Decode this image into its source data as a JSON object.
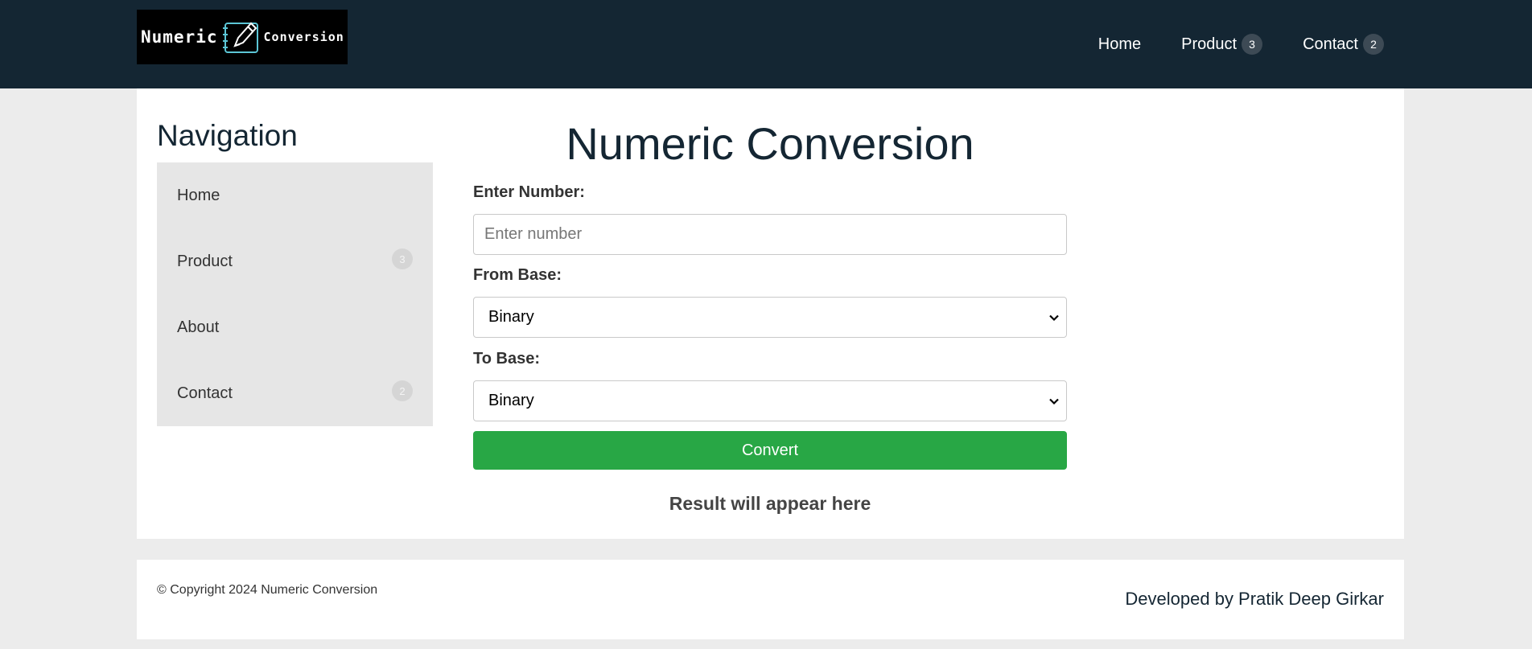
{
  "header": {
    "logo": {
      "word1": "Numeric",
      "word2": "Conversion",
      "icon": "pen-tablet-icon"
    },
    "nav": [
      {
        "label": "Home",
        "badge": ""
      },
      {
        "label": "Product",
        "badge": "3"
      },
      {
        "label": "Contact",
        "badge": "2"
      }
    ]
  },
  "sidebar": {
    "title": "Navigation",
    "items": [
      {
        "label": "Home",
        "badge": ""
      },
      {
        "label": "Product",
        "badge": "3"
      },
      {
        "label": "About",
        "badge": ""
      },
      {
        "label": "Contact",
        "badge": "2"
      }
    ]
  },
  "converter": {
    "title": "Numeric Conversion",
    "number_label": "Enter Number:",
    "number_placeholder": "Enter number",
    "number_value": "",
    "from_label": "From Base:",
    "from_value": "Binary",
    "to_label": "To Base:",
    "to_value": "Binary",
    "convert_label": "Convert",
    "result_text": "Result will appear here"
  },
  "footer": {
    "copyright": "© Copyright 2024 Numeric Conversion",
    "developer": "Developed by Pratik Deep Girkar"
  },
  "colors": {
    "header_bg": "#142633",
    "convert_button": "#28a745",
    "sidebar_bg": "#e6e6e6",
    "page_bg": "#ececec"
  }
}
